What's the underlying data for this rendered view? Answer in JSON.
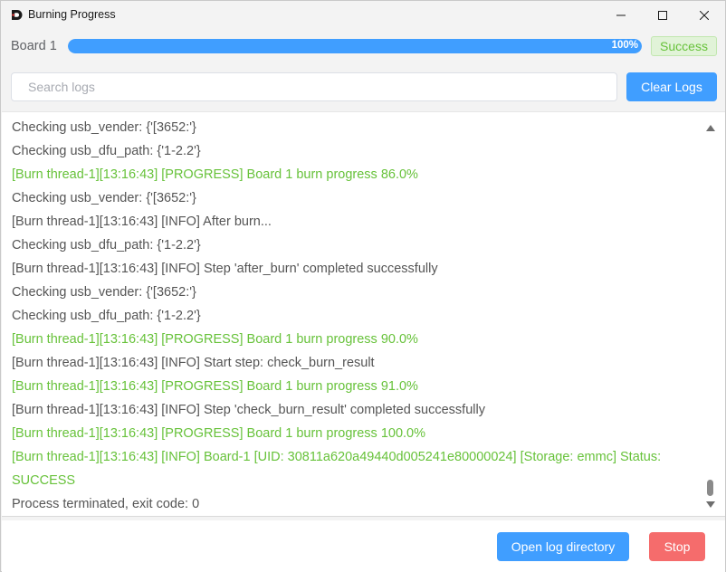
{
  "window": {
    "title": "Burning Progress",
    "app_icon": "app-logo-icon",
    "controls": [
      "minimize-icon",
      "maximize-icon",
      "close-icon"
    ]
  },
  "progress": {
    "board_label": "Board 1",
    "percent_text": "100%",
    "value": 1.0,
    "status": "Success",
    "colors": {
      "fill": "#409eff",
      "success_text": "#67c23a",
      "success_bg": "#e1f3d8"
    }
  },
  "search": {
    "placeholder": "Search logs",
    "value": "",
    "clear_label": "Clear Logs"
  },
  "logs": [
    {
      "text": "Checking usb_vender: {'[3652:'}",
      "type": "info"
    },
    {
      "text": "Checking usb_dfu_path: {'1-2.2'}",
      "type": "info"
    },
    {
      "text": "[Burn thread-1][13:16:43] [PROGRESS] Board 1 burn progress 86.0%",
      "type": "progress"
    },
    {
      "text": "Checking usb_vender: {'[3652:'}",
      "type": "info"
    },
    {
      "text": "[Burn thread-1][13:16:43] [INFO] After burn...",
      "type": "info"
    },
    {
      "text": "Checking usb_dfu_path: {'1-2.2'}",
      "type": "info"
    },
    {
      "text": "[Burn thread-1][13:16:43] [INFO] Step 'after_burn' completed successfully",
      "type": "info"
    },
    {
      "text": "Checking usb_vender: {'[3652:'}",
      "type": "info"
    },
    {
      "text": "Checking usb_dfu_path: {'1-2.2'}",
      "type": "info"
    },
    {
      "text": "[Burn thread-1][13:16:43] [PROGRESS] Board 1 burn progress 90.0%",
      "type": "progress"
    },
    {
      "text": "[Burn thread-1][13:16:43] [INFO] Start step: check_burn_result",
      "type": "info"
    },
    {
      "text": "[Burn thread-1][13:16:43] [PROGRESS] Board 1 burn progress 91.0%",
      "type": "progress"
    },
    {
      "text": "[Burn thread-1][13:16:43] [INFO] Step 'check_burn_result' completed successfully",
      "type": "info"
    },
    {
      "text": "[Burn thread-1][13:16:43] [PROGRESS] Board 1 burn progress 100.0%",
      "type": "progress"
    },
    {
      "text": "[Burn thread-1][13:16:43] [INFO] Board-1 [UID: 30811a620a49440d005241e80000024] [Storage: emmc] Status: SUCCESS",
      "type": "success"
    },
    {
      "text": "Process terminated, exit code: 0",
      "type": "info"
    }
  ],
  "footer": {
    "open_dir_label": "Open log directory",
    "stop_label": "Stop"
  }
}
